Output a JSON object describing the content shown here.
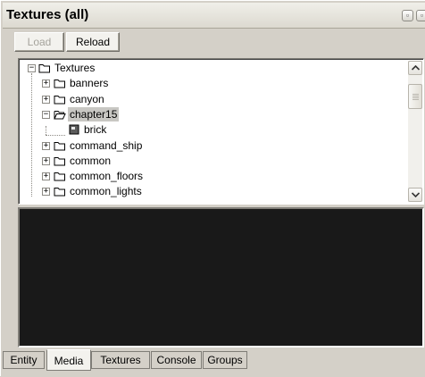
{
  "window": {
    "title": "Textures (all)"
  },
  "toolbar": {
    "load_label": "Load",
    "reload_label": "Reload"
  },
  "tree": {
    "nodes": [
      {
        "label": "Textures",
        "expander": "−",
        "icon": "folder-icon",
        "expanded": true,
        "selected": false
      },
      {
        "label": "banners",
        "expander": "+",
        "icon": "folder-icon",
        "expanded": false,
        "selected": false
      },
      {
        "label": "canyon",
        "expander": "+",
        "icon": "folder-icon",
        "expanded": false,
        "selected": false
      },
      {
        "label": "chapter15",
        "expander": "−",
        "icon": "folder-open-icon",
        "expanded": true,
        "selected": true
      },
      {
        "label": "brick",
        "expander": "",
        "icon": "texture-file-icon",
        "expanded": false,
        "selected": false
      },
      {
        "label": "command_ship",
        "expander": "+",
        "icon": "folder-icon",
        "expanded": false,
        "selected": false
      },
      {
        "label": "common",
        "expander": "+",
        "icon": "folder-icon",
        "expanded": false,
        "selected": false
      },
      {
        "label": "common_floors",
        "expander": "+",
        "icon": "folder-icon",
        "expanded": false,
        "selected": false
      },
      {
        "label": "common_lights",
        "expander": "+",
        "icon": "folder-icon",
        "expanded": false,
        "selected": false
      }
    ]
  },
  "tabs": [
    {
      "label": "Entity",
      "active": false
    },
    {
      "label": "Media",
      "active": true
    },
    {
      "label": "Textures",
      "active": false
    },
    {
      "label": "Console",
      "active": false
    },
    {
      "label": "Groups",
      "active": false
    }
  ],
  "colors": {
    "panel_background": "#d4d0c8",
    "console_background": "#191919",
    "selection_highlight": "#c8c7c3"
  }
}
